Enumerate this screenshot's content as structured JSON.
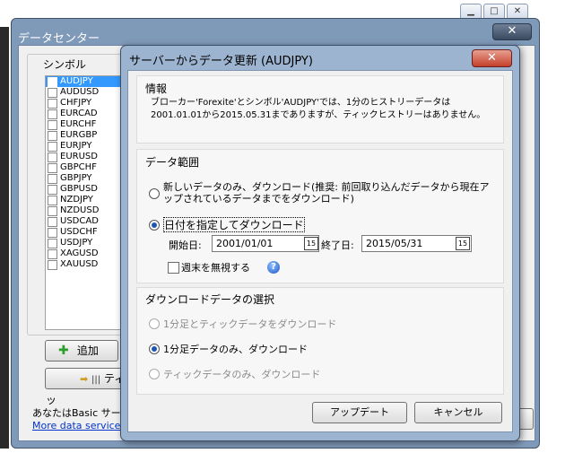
{
  "main_window": {
    "title": "データセンター",
    "symbol_group_label": "シンボル",
    "symbols": [
      {
        "name": "AUDJPY",
        "selected": true
      },
      {
        "name": "AUDUSD",
        "selected": false
      },
      {
        "name": "CHFJPY",
        "selected": false
      },
      {
        "name": "EURCAD",
        "selected": false
      },
      {
        "name": "EURCHF",
        "selected": false
      },
      {
        "name": "EURGBP",
        "selected": false
      },
      {
        "name": "EURJPY",
        "selected": false
      },
      {
        "name": "EURUSD",
        "selected": false
      },
      {
        "name": "GBPCHF",
        "selected": false
      },
      {
        "name": "GBPJPY",
        "selected": false
      },
      {
        "name": "GBPUSD",
        "selected": false
      },
      {
        "name": "NZDJPY",
        "selected": false
      },
      {
        "name": "NZDUSD",
        "selected": false
      },
      {
        "name": "USDCAD",
        "selected": false
      },
      {
        "name": "USDCHF",
        "selected": false
      },
      {
        "name": "USDJPY",
        "selected": false
      },
      {
        "name": "XAGUSD",
        "selected": false
      },
      {
        "name": "XAUUSD",
        "selected": false
      }
    ],
    "add_button_label": "追加",
    "tick_button_label": "ティッ",
    "basic_text": "あなたはBasic サービ",
    "more_link": "More data service or",
    "close_glyph": "✕"
  },
  "dialog": {
    "title": "サーバーからデータ更新 (AUDJPY)",
    "close_glyph": "✕",
    "info": {
      "heading": "情報",
      "text": "ブローカー'Forexite'とシンボル'AUDJPY'では、1分のヒストリーデータは2001.01.01から2015.05.31までありますが、ティックヒストリーはありません。"
    },
    "range": {
      "heading": "データ範囲",
      "option_new_only": "新しいデータのみ、ダウンロード(推奨: 前回取り込んだデータから現在アップされているデータまでをダウンロード)",
      "option_by_date": "日付を指定してダウンロード",
      "start_label": "開始日:",
      "start_value": "2001/01/01",
      "end_label": "終了日:",
      "end_value": "2015/05/31",
      "calendar_glyph": "15",
      "ignore_weekend_label": "週末を無視する",
      "selected": "by_date"
    },
    "download_select": {
      "heading": "ダウンロードデータの選択",
      "option_1min_and_tick": "1分足とティックデータをダウンロード",
      "option_1min_only": "1分足データのみ、ダウンロード",
      "option_tick_only": "ティックデータのみ、ダウンロード",
      "selected": "1min_only"
    },
    "update_button_label": "アップデート",
    "cancel_button_label": "キャンセル"
  },
  "colors": {
    "selection": "#3399ff",
    "radio_dot": "#1e55b5",
    "dialog_close": "#c4402a"
  }
}
